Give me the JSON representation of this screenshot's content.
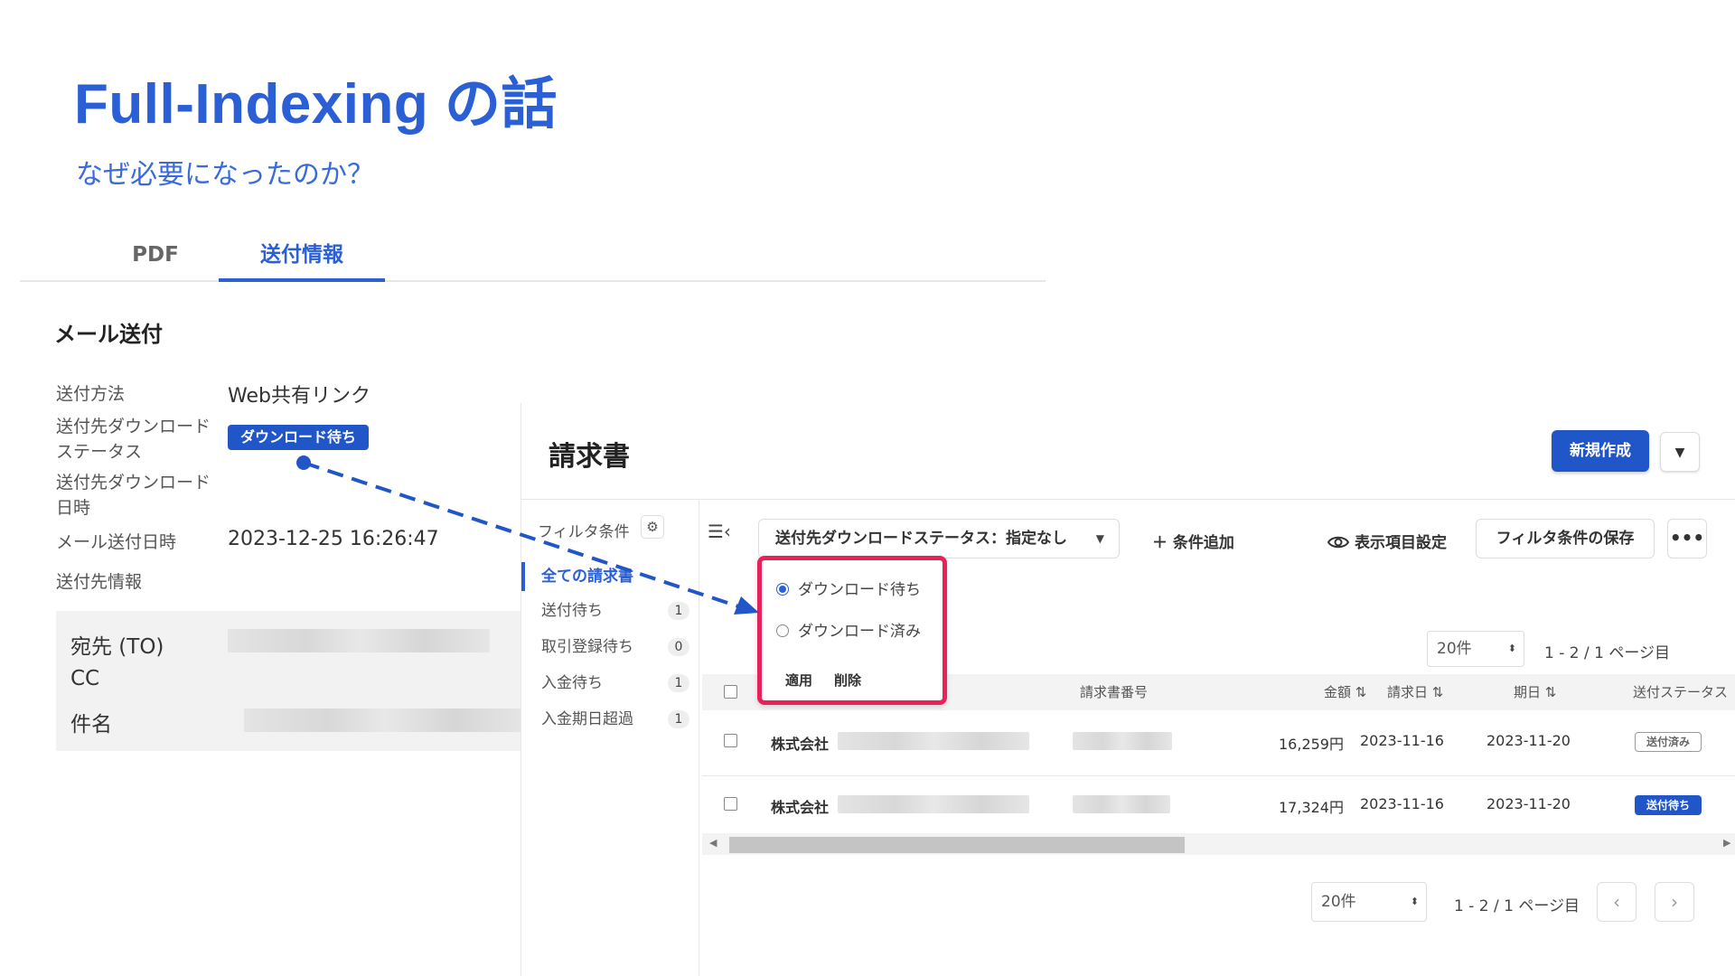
{
  "slide": {
    "title": "Full-Indexing の話",
    "subtitle": "なぜ必要になったのか？"
  },
  "detail": {
    "tabs": [
      "PDF",
      "送付情報"
    ],
    "active_tab": "送付情報",
    "section_title": "メール送付",
    "labels": {
      "method": "送付方法",
      "dl_status_1": "送付先ダウンロード",
      "dl_status_2": "ステータス",
      "dl_date_1": "送付先ダウンロード",
      "dl_date_2": "日時",
      "mail_date": "メール送付日時",
      "recipient_info": "送付先情報"
    },
    "values": {
      "method": "Web共有リンク",
      "dl_status_badge": "ダウンロード待ち",
      "mail_date": "2023-12-25 16:26:47"
    },
    "recipient": {
      "to_label": "宛先 (TO)",
      "cc_label": "CC",
      "subject_label": "件名"
    }
  },
  "invoice": {
    "title": "請求書",
    "new_button": "新規作成",
    "filter_header": "フィルタ条件",
    "sidebar": [
      {
        "label": "全ての請求書",
        "count": null,
        "active": true
      },
      {
        "label": "送付待ち",
        "count": "1"
      },
      {
        "label": "取引登録待ち",
        "count": "0"
      },
      {
        "label": "入金待ち",
        "count": "1"
      },
      {
        "label": "入金期日超過",
        "count": "1"
      }
    ],
    "toolbar": {
      "filter_dropdown": "送付先ダウンロードステータス：指定なし",
      "add_condition": "条件追加",
      "display_settings": "表示項目設定",
      "save_filter": "フィルタ条件の保存",
      "more": "•••"
    },
    "popup": {
      "options": [
        "ダウンロード待ち",
        "ダウンロード済み"
      ],
      "selected": "ダウンロード待ち",
      "apply": "適用",
      "delete": "削除"
    },
    "pagination": {
      "per_page": "20件",
      "page_info": "1 - 2 / 1 ページ目"
    },
    "columns": [
      "請求書番号",
      "金額",
      "請求日",
      "期日",
      "送付ステータス"
    ],
    "rows": [
      {
        "company": "株式会社",
        "amount": "16,259円",
        "invoice_date": "2023-11-16",
        "due_date": "2023-11-20",
        "status": "送付済み"
      },
      {
        "company": "株式会社",
        "amount": "17,324円",
        "invoice_date": "2023-11-16",
        "due_date": "2023-11-20",
        "status": "送付待ち"
      }
    ]
  },
  "colors": {
    "accent": "#2a5fd6",
    "primary_button": "#2056c7",
    "highlight_border": "#e8215a"
  }
}
